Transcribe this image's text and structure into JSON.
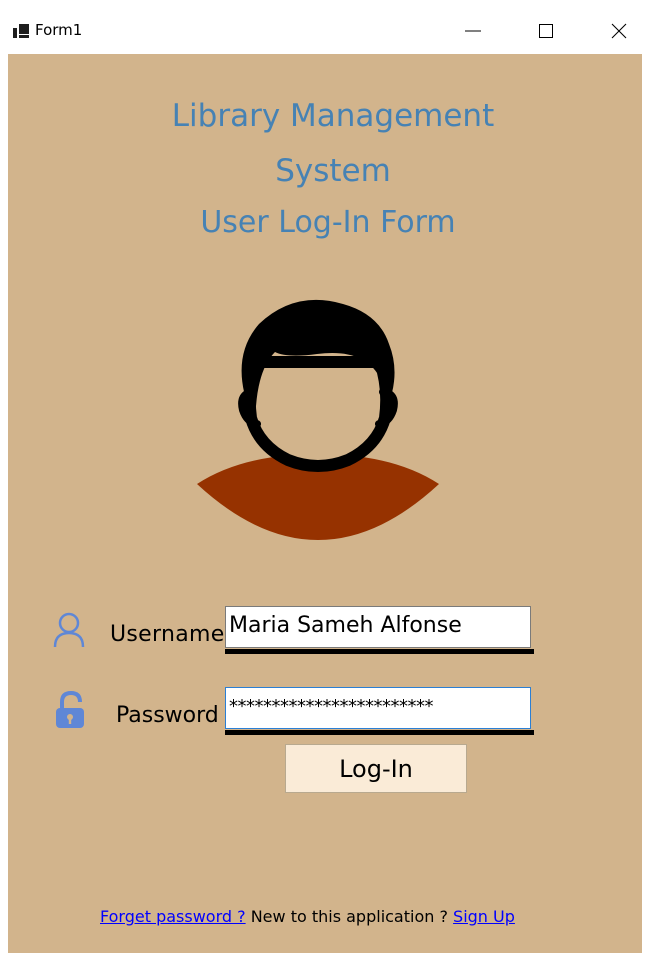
{
  "window": {
    "title": "Form1"
  },
  "header": {
    "line1": "Library Management",
    "line2": "System",
    "subtitle": "User Log-In Form"
  },
  "form": {
    "username_label": "Username",
    "username_value": "Maria Sameh Alfonse",
    "password_label": "Password",
    "password_value": "************************",
    "login_label": "Log-In"
  },
  "footer": {
    "forget_link": "Forget password ?",
    "middle_text": " New to this application ? ",
    "signup_link": "Sign Up"
  },
  "colors": {
    "background": "#d2b48c",
    "heading": "#4682b4",
    "icon": "#5f87d6",
    "avatar_hair": "#000000",
    "avatar_shirt": "#963200",
    "button": "#faebd7",
    "link": "#0000ff"
  },
  "icons": {
    "app": "windows-form-icon",
    "user": "user-outline-icon",
    "lock": "unlocked-padlock-icon"
  }
}
